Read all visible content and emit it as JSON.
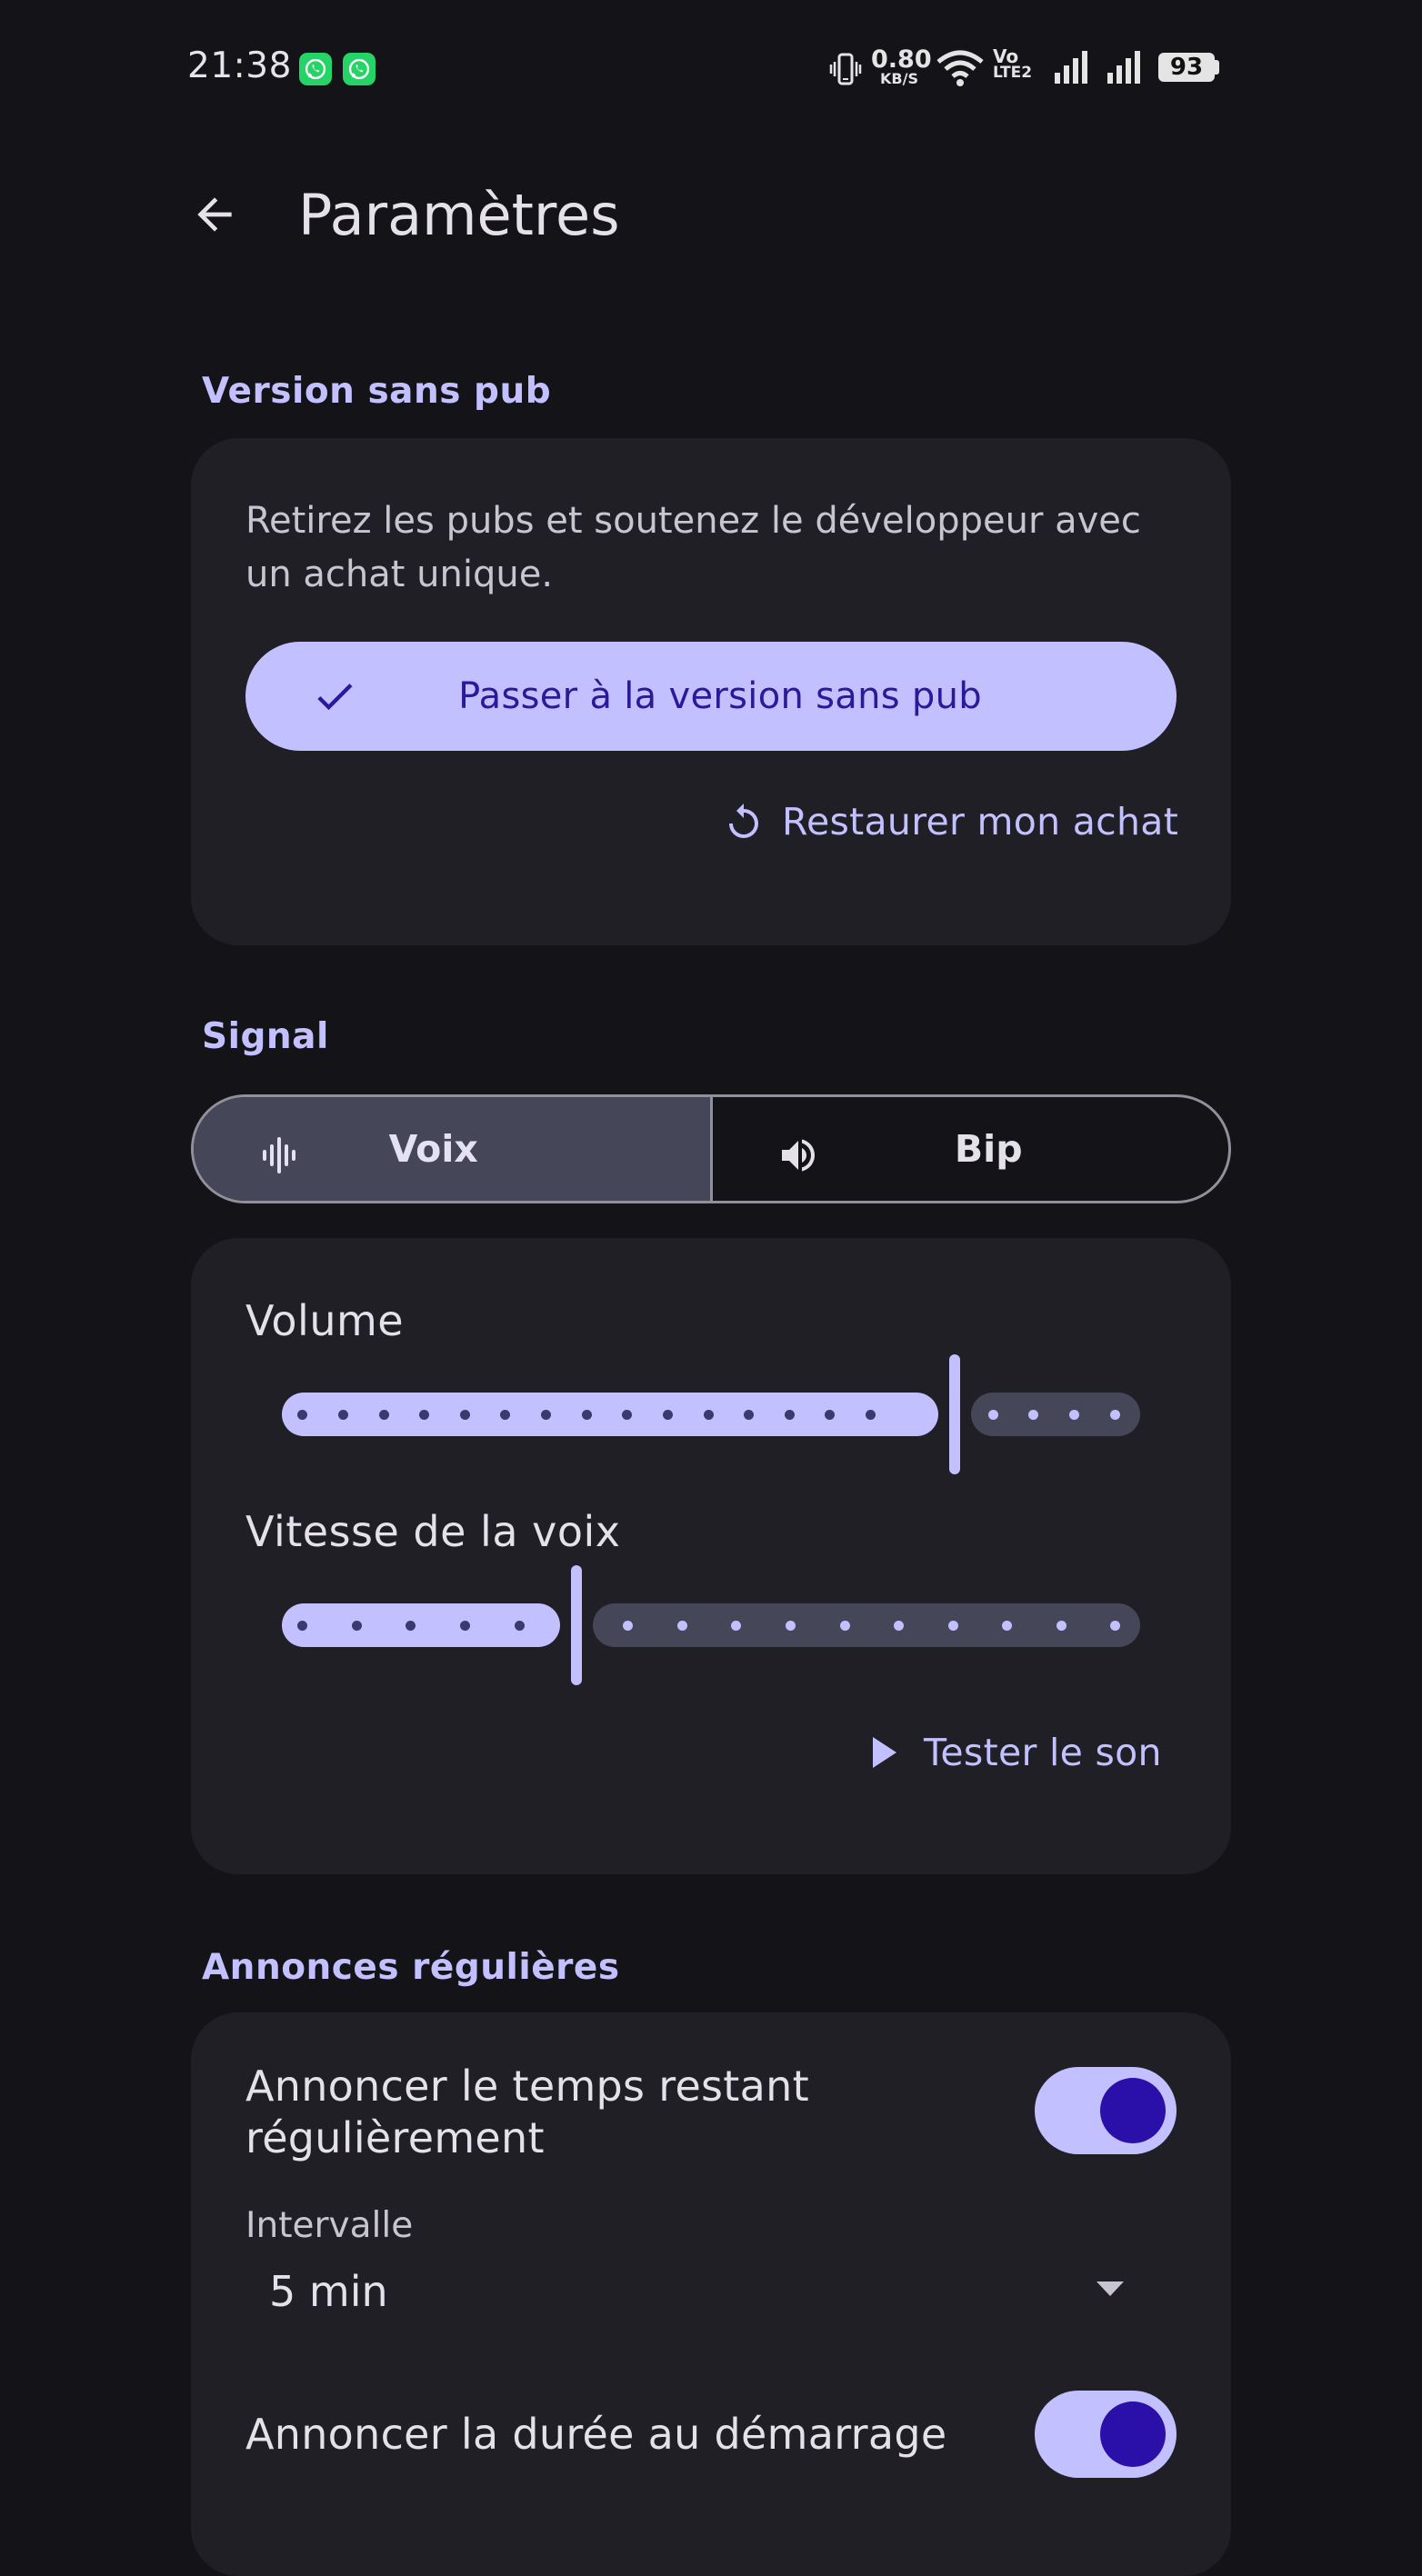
{
  "status_bar": {
    "time": "21:38",
    "net_speed_value": "0.80",
    "net_speed_unit": "KB/S",
    "volte_top": "Vo",
    "volte_bottom": "LTE2",
    "battery": "93"
  },
  "app_bar": {
    "title": "Paramètres"
  },
  "ad_free": {
    "section_title": "Version sans pub",
    "description": "Retirez les pubs et soutenez le développeur avec un achat unique.",
    "upgrade_label": "Passer à la version sans pub",
    "restore_label": "Restaurer mon achat"
  },
  "signal": {
    "section_title": "Signal",
    "options": [
      {
        "label": "Voix",
        "selected": true,
        "icon": "waveform-icon"
      },
      {
        "label": "Bip",
        "selected": false,
        "icon": "speaker-icon"
      }
    ],
    "volume_label": "Volume",
    "volume_fraction": 0.79,
    "speed_label": "Vitesse de la voix",
    "speed_fraction": 0.34,
    "test_label": "Tester le son"
  },
  "announcements": {
    "section_title": "Annonces régulières",
    "periodic_label": "Annoncer le temps restant régulièrement",
    "periodic_enabled": true,
    "interval_label": "Intervalle",
    "interval_value": "5 min",
    "start_label": "Annoncer la durée au démarrage",
    "start_enabled": true
  },
  "colors": {
    "background": "#131318",
    "card": "#1f1f25",
    "accent": "#c3c0ff",
    "accent_dark": "#2a0fa8",
    "segment_selected": "#454759"
  }
}
